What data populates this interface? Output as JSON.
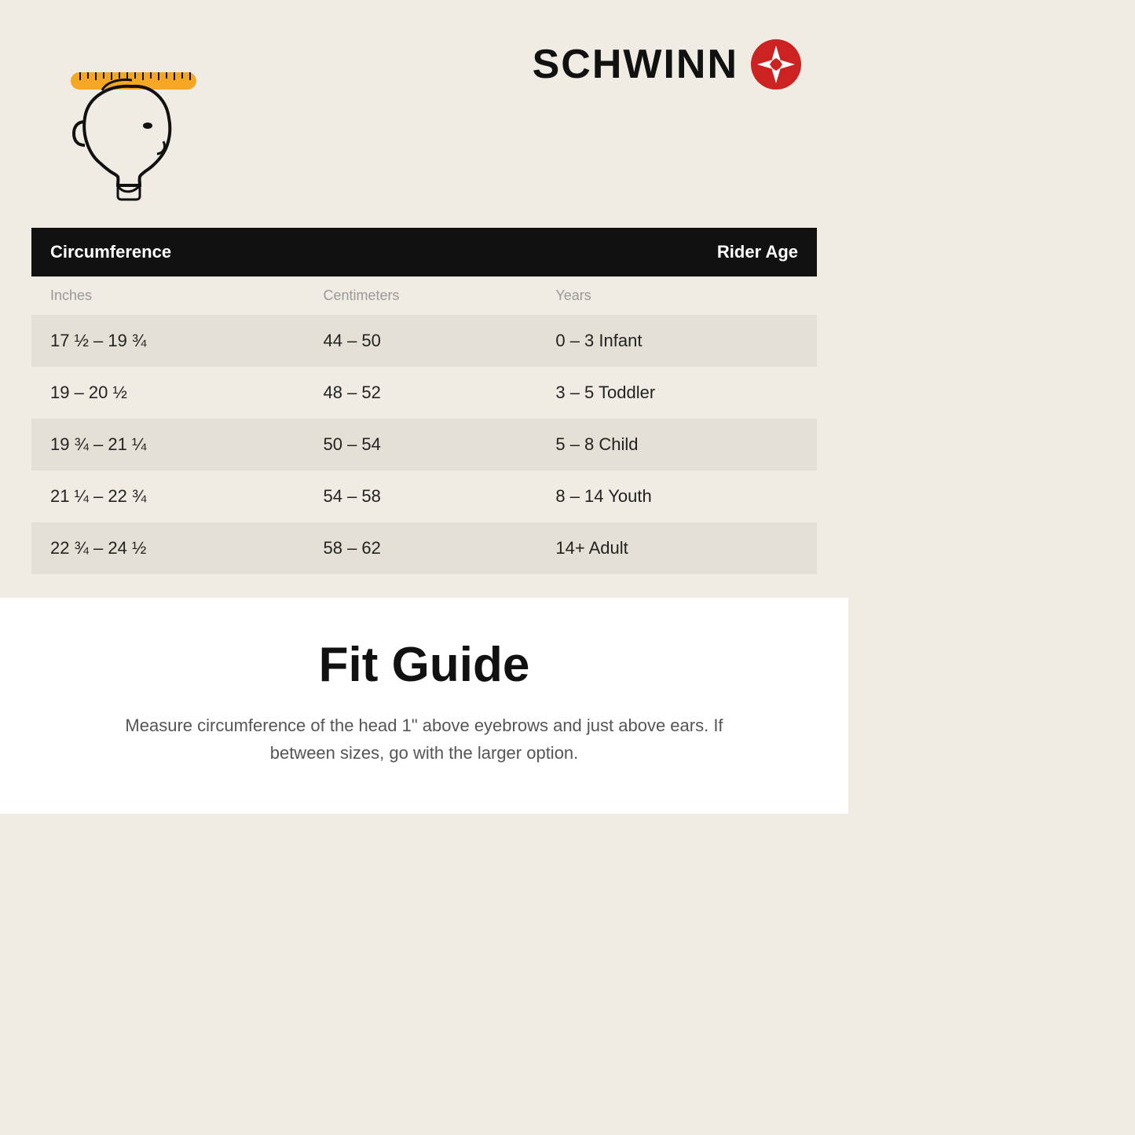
{
  "brand": {
    "name": "SCHWINN",
    "trademark": "®"
  },
  "table": {
    "header": {
      "col1": "Circumference",
      "col2": "",
      "col3": "Rider Age"
    },
    "subheader": {
      "col1": "Inches",
      "col2": "Centimeters",
      "col3": "Years"
    },
    "rows": [
      {
        "inches": "17 ½ – 19 ¾",
        "cm": "44 – 50",
        "age": "0 – 3 Infant"
      },
      {
        "inches": "19 – 20 ½",
        "cm": "48 – 52",
        "age": "3 – 5 Toddler"
      },
      {
        "inches": "19 ¾ – 21 ¼",
        "cm": "50 – 54",
        "age": "5 – 8 Child"
      },
      {
        "inches": "21 ¼ – 22 ¾",
        "cm": "54 – 58",
        "age": "8 – 14 Youth"
      },
      {
        "inches": "22 ¾ – 24 ½",
        "cm": "58 – 62",
        "age": "14+ Adult"
      }
    ]
  },
  "fit_guide": {
    "title": "Fit Guide",
    "description": "Measure circumference of the head 1\" above eyebrows and just above ears. If between sizes, go with the larger option."
  }
}
